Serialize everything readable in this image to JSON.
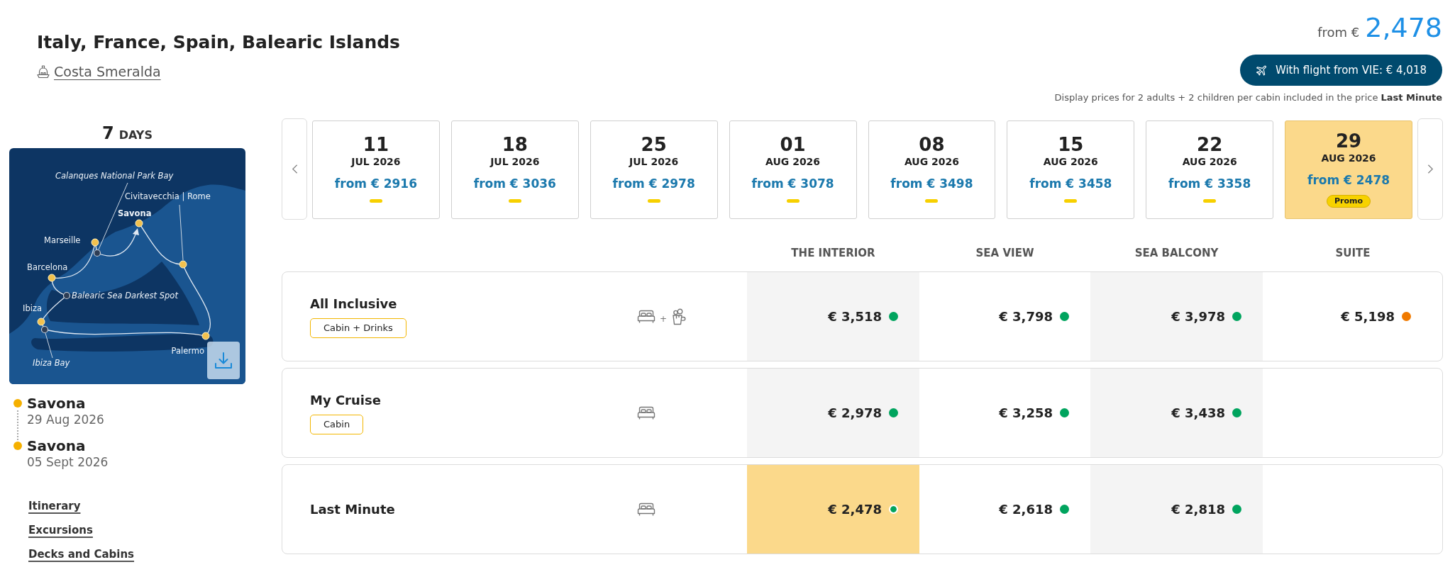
{
  "header": {
    "title": "Italy, France, Spain, Balearic Islands",
    "ship": "Costa Smeralda"
  },
  "price_summary": {
    "prefix": "from €",
    "amount": "2,478",
    "flight_button": "With flight from VIE: € 4,018",
    "note": "Display prices for 2 adults + 2 children per cabin included in the price **Last Minute**"
  },
  "duration": {
    "number": "7",
    "unit": "DAYS"
  },
  "route_map": {
    "labels": [
      {
        "text": "Calanques National Park Bay",
        "kind": "scenic"
      },
      {
        "text": "Civitavecchia | Rome",
        "kind": "port"
      },
      {
        "text": "Savona",
        "kind": "home"
      },
      {
        "text": "Marseille",
        "kind": "port"
      },
      {
        "text": "Barcelona",
        "kind": "port"
      },
      {
        "text": "Balearic Sea Darkest Spot",
        "kind": "scenic"
      },
      {
        "text": "Ibiza",
        "kind": "port"
      },
      {
        "text": "Palermo",
        "kind": "port"
      },
      {
        "text": "Ibiza Bay",
        "kind": "scenic"
      }
    ]
  },
  "itinerary_summary": [
    {
      "port": "Savona",
      "date": "29 Aug 2026"
    },
    {
      "port": "Savona",
      "date": "05 Sept 2026"
    }
  ],
  "links": [
    "Itinerary",
    "Excursions",
    "Decks and Cabins"
  ],
  "dates": [
    {
      "day": "11",
      "month": "JUL 2026",
      "price": "from € 2916",
      "marker": true,
      "selected": false
    },
    {
      "day": "18",
      "month": "JUL 2026",
      "price": "from € 3036",
      "marker": true,
      "selected": false
    },
    {
      "day": "25",
      "month": "JUL 2026",
      "price": "from € 2978",
      "marker": true,
      "selected": false
    },
    {
      "day": "01",
      "month": "AUG 2026",
      "price": "from € 3078",
      "marker": true,
      "selected": false
    },
    {
      "day": "08",
      "month": "AUG 2026",
      "price": "from € 3498",
      "marker": true,
      "selected": false
    },
    {
      "day": "15",
      "month": "AUG 2026",
      "price": "from € 3458",
      "marker": true,
      "selected": false
    },
    {
      "day": "22",
      "month": "AUG 2026",
      "price": "from € 3358",
      "marker": true,
      "selected": false
    },
    {
      "day": "29",
      "month": "AUG 2026",
      "price": "from € 2478",
      "badge": "Promo",
      "marker": false,
      "selected": true
    }
  ],
  "cabin_table": {
    "columns": [
      "THE INTERIOR",
      "SEA VIEW",
      "SEA BALCONY",
      "SUITE"
    ],
    "rows": [
      {
        "name": "All Inclusive",
        "tag": "Cabin + Drinks",
        "amenities": [
          {
            "kind": "bed"
          },
          {
            "kind": "drinks"
          }
        ],
        "amenity_separator": "+",
        "prices": [
          {
            "price": "€ 3,518",
            "color": "#00a45e",
            "selected": false
          },
          {
            "price": "€ 3,798",
            "color": "#00a45e",
            "selected": false
          },
          {
            "price": "€ 3,978",
            "color": "#00a45e",
            "selected": false
          },
          {
            "price": "€ 5,198",
            "color": "#f07a00",
            "selected": false
          }
        ]
      },
      {
        "name": "My Cruise",
        "tag": "Cabin",
        "amenities": [
          {
            "kind": "bed"
          }
        ],
        "prices": [
          {
            "price": "€ 2,978",
            "color": "#00a45e",
            "selected": false
          },
          {
            "price": "€ 3,258",
            "color": "#00a45e",
            "selected": false
          },
          {
            "price": "€ 3,438",
            "color": "#00a45e",
            "selected": false
          }
        ]
      },
      {
        "name": "Last Minute",
        "amenities": [
          {
            "kind": "bed"
          }
        ],
        "prices": [
          {
            "price": "€ 2,478",
            "color": "#00a45e",
            "selected": true
          },
          {
            "price": "€ 2,618",
            "color": "#00a45e",
            "selected": false
          },
          {
            "price": "€ 2,818",
            "color": "#00a45e",
            "selected": false
          }
        ]
      }
    ]
  }
}
